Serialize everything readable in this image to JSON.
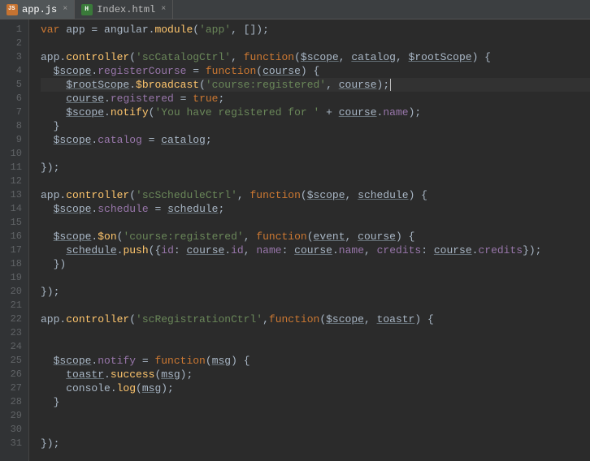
{
  "tabs": [
    {
      "name": "app.js",
      "active": true,
      "icon": "js"
    },
    {
      "name": "Index.html",
      "active": false,
      "icon": "html"
    }
  ],
  "code": {
    "lines": [
      {
        "n": 1,
        "seg": [
          {
            "t": "var ",
            "c": "kw"
          },
          {
            "t": "app = angular.",
            "c": "punc"
          },
          {
            "t": "module",
            "c": "fn"
          },
          {
            "t": "(",
            "c": "punc"
          },
          {
            "t": "'app'",
            "c": "str"
          },
          {
            "t": ", []);",
            "c": "punc"
          }
        ]
      },
      {
        "n": 2,
        "seg": []
      },
      {
        "n": 3,
        "seg": [
          {
            "t": "app.",
            "c": "punc"
          },
          {
            "t": "controller",
            "c": "fn"
          },
          {
            "t": "(",
            "c": "punc"
          },
          {
            "t": "'scCatalogCtrl'",
            "c": "str"
          },
          {
            "t": ", ",
            "c": "punc"
          },
          {
            "t": "function",
            "c": "kw"
          },
          {
            "t": "(",
            "c": "punc"
          },
          {
            "t": "$scope",
            "c": "par"
          },
          {
            "t": ", ",
            "c": "punc"
          },
          {
            "t": "catalog",
            "c": "par"
          },
          {
            "t": ", ",
            "c": "punc"
          },
          {
            "t": "$rootScope",
            "c": "par"
          },
          {
            "t": ") {",
            "c": "punc"
          }
        ]
      },
      {
        "n": 4,
        "seg": [
          {
            "t": "  ",
            "c": ""
          },
          {
            "t": "$scope",
            "c": "par"
          },
          {
            "t": ".",
            "c": "punc"
          },
          {
            "t": "registerCourse",
            "c": "id"
          },
          {
            "t": " = ",
            "c": "punc"
          },
          {
            "t": "function",
            "c": "kw"
          },
          {
            "t": "(",
            "c": "punc"
          },
          {
            "t": "course",
            "c": "par"
          },
          {
            "t": ") {",
            "c": "punc"
          }
        ]
      },
      {
        "n": 5,
        "hl": true,
        "seg": [
          {
            "t": "    ",
            "c": ""
          },
          {
            "t": "$rootScope",
            "c": "par"
          },
          {
            "t": ".",
            "c": "punc"
          },
          {
            "t": "$broadcast",
            "c": "fn"
          },
          {
            "t": "(",
            "c": "punc"
          },
          {
            "t": "'course:registered'",
            "c": "str"
          },
          {
            "t": ", ",
            "c": "punc"
          },
          {
            "t": "course",
            "c": "par"
          },
          {
            "t": ");",
            "c": "punc"
          },
          {
            "t": "",
            "c": "caret"
          }
        ]
      },
      {
        "n": 6,
        "seg": [
          {
            "t": "    ",
            "c": ""
          },
          {
            "t": "course",
            "c": "par"
          },
          {
            "t": ".",
            "c": "punc"
          },
          {
            "t": "registered",
            "c": "id"
          },
          {
            "t": " = ",
            "c": "punc"
          },
          {
            "t": "true",
            "c": "bool"
          },
          {
            "t": ";",
            "c": "punc"
          }
        ]
      },
      {
        "n": 7,
        "seg": [
          {
            "t": "    ",
            "c": ""
          },
          {
            "t": "$scope",
            "c": "par"
          },
          {
            "t": ".",
            "c": "punc"
          },
          {
            "t": "notify",
            "c": "fn"
          },
          {
            "t": "(",
            "c": "punc"
          },
          {
            "t": "'You have registered for '",
            "c": "str"
          },
          {
            "t": " + ",
            "c": "punc"
          },
          {
            "t": "course",
            "c": "par"
          },
          {
            "t": ".",
            "c": "punc"
          },
          {
            "t": "name",
            "c": "id"
          },
          {
            "t": ");",
            "c": "punc"
          }
        ]
      },
      {
        "n": 8,
        "seg": [
          {
            "t": "  }",
            "c": "punc"
          }
        ]
      },
      {
        "n": 9,
        "seg": [
          {
            "t": "  ",
            "c": ""
          },
          {
            "t": "$scope",
            "c": "par"
          },
          {
            "t": ".",
            "c": "punc"
          },
          {
            "t": "catalog",
            "c": "id"
          },
          {
            "t": " = ",
            "c": "punc"
          },
          {
            "t": "catalog",
            "c": "par"
          },
          {
            "t": ";",
            "c": "punc"
          }
        ]
      },
      {
        "n": 10,
        "seg": []
      },
      {
        "n": 11,
        "seg": [
          {
            "t": "});",
            "c": "punc"
          }
        ]
      },
      {
        "n": 12,
        "seg": []
      },
      {
        "n": 13,
        "seg": [
          {
            "t": "app.",
            "c": "punc"
          },
          {
            "t": "controller",
            "c": "fn"
          },
          {
            "t": "(",
            "c": "punc"
          },
          {
            "t": "'scScheduleCtrl'",
            "c": "str"
          },
          {
            "t": ", ",
            "c": "punc"
          },
          {
            "t": "function",
            "c": "kw"
          },
          {
            "t": "(",
            "c": "punc"
          },
          {
            "t": "$scope",
            "c": "par"
          },
          {
            "t": ", ",
            "c": "punc"
          },
          {
            "t": "schedule",
            "c": "par"
          },
          {
            "t": ") {",
            "c": "punc"
          }
        ]
      },
      {
        "n": 14,
        "seg": [
          {
            "t": "  ",
            "c": ""
          },
          {
            "t": "$scope",
            "c": "par"
          },
          {
            "t": ".",
            "c": "punc"
          },
          {
            "t": "schedule",
            "c": "id"
          },
          {
            "t": " = ",
            "c": "punc"
          },
          {
            "t": "schedule",
            "c": "par"
          },
          {
            "t": ";",
            "c": "punc"
          }
        ]
      },
      {
        "n": 15,
        "seg": []
      },
      {
        "n": 16,
        "seg": [
          {
            "t": "  ",
            "c": ""
          },
          {
            "t": "$scope",
            "c": "par"
          },
          {
            "t": ".",
            "c": "punc"
          },
          {
            "t": "$on",
            "c": "fn"
          },
          {
            "t": "(",
            "c": "punc"
          },
          {
            "t": "'course:registered'",
            "c": "str"
          },
          {
            "t": ", ",
            "c": "punc"
          },
          {
            "t": "function",
            "c": "kw"
          },
          {
            "t": "(",
            "c": "punc"
          },
          {
            "t": "event",
            "c": "par"
          },
          {
            "t": ", ",
            "c": "punc"
          },
          {
            "t": "course",
            "c": "par"
          },
          {
            "t": ") {",
            "c": "punc"
          }
        ]
      },
      {
        "n": 17,
        "seg": [
          {
            "t": "    ",
            "c": ""
          },
          {
            "t": "schedule",
            "c": "par"
          },
          {
            "t": ".",
            "c": "punc"
          },
          {
            "t": "push",
            "c": "fn"
          },
          {
            "t": "({",
            "c": "punc"
          },
          {
            "t": "id",
            "c": "id"
          },
          {
            "t": ": ",
            "c": "punc"
          },
          {
            "t": "course",
            "c": "par"
          },
          {
            "t": ".",
            "c": "punc"
          },
          {
            "t": "id",
            "c": "id"
          },
          {
            "t": ", ",
            "c": "punc"
          },
          {
            "t": "name",
            "c": "id"
          },
          {
            "t": ": ",
            "c": "punc"
          },
          {
            "t": "course",
            "c": "par"
          },
          {
            "t": ".",
            "c": "punc"
          },
          {
            "t": "name",
            "c": "id"
          },
          {
            "t": ", ",
            "c": "punc"
          },
          {
            "t": "credits",
            "c": "id"
          },
          {
            "t": ": ",
            "c": "punc"
          },
          {
            "t": "course",
            "c": "par"
          },
          {
            "t": ".",
            "c": "punc"
          },
          {
            "t": "credits",
            "c": "id"
          },
          {
            "t": "});",
            "c": "punc"
          }
        ]
      },
      {
        "n": 18,
        "seg": [
          {
            "t": "  })",
            "c": "punc"
          }
        ]
      },
      {
        "n": 19,
        "seg": []
      },
      {
        "n": 20,
        "seg": [
          {
            "t": "});",
            "c": "punc"
          }
        ]
      },
      {
        "n": 21,
        "seg": []
      },
      {
        "n": 22,
        "seg": [
          {
            "t": "app.",
            "c": "punc"
          },
          {
            "t": "controller",
            "c": "fn"
          },
          {
            "t": "(",
            "c": "punc"
          },
          {
            "t": "'scRegistrationCtrl'",
            "c": "str"
          },
          {
            "t": ",",
            "c": "punc"
          },
          {
            "t": "function",
            "c": "kw"
          },
          {
            "t": "(",
            "c": "punc"
          },
          {
            "t": "$scope",
            "c": "par"
          },
          {
            "t": ", ",
            "c": "punc"
          },
          {
            "t": "toastr",
            "c": "par"
          },
          {
            "t": ") {",
            "c": "punc"
          }
        ]
      },
      {
        "n": 23,
        "seg": []
      },
      {
        "n": 24,
        "seg": []
      },
      {
        "n": 25,
        "seg": [
          {
            "t": "  ",
            "c": ""
          },
          {
            "t": "$scope",
            "c": "par"
          },
          {
            "t": ".",
            "c": "punc"
          },
          {
            "t": "notify",
            "c": "id"
          },
          {
            "t": " = ",
            "c": "punc"
          },
          {
            "t": "function",
            "c": "kw"
          },
          {
            "t": "(",
            "c": "punc"
          },
          {
            "t": "msg",
            "c": "par"
          },
          {
            "t": ") {",
            "c": "punc"
          }
        ]
      },
      {
        "n": 26,
        "seg": [
          {
            "t": "    ",
            "c": ""
          },
          {
            "t": "toastr",
            "c": "par"
          },
          {
            "t": ".",
            "c": "punc"
          },
          {
            "t": "success",
            "c": "fn"
          },
          {
            "t": "(",
            "c": "punc"
          },
          {
            "t": "msg",
            "c": "par"
          },
          {
            "t": ");",
            "c": "punc"
          }
        ]
      },
      {
        "n": 27,
        "seg": [
          {
            "t": "    console.",
            "c": "punc"
          },
          {
            "t": "log",
            "c": "fn"
          },
          {
            "t": "(",
            "c": "punc"
          },
          {
            "t": "msg",
            "c": "par"
          },
          {
            "t": ");",
            "c": "punc"
          }
        ]
      },
      {
        "n": 28,
        "seg": [
          {
            "t": "  }",
            "c": "punc"
          }
        ]
      },
      {
        "n": 29,
        "seg": []
      },
      {
        "n": 30,
        "seg": []
      },
      {
        "n": 31,
        "seg": [
          {
            "t": "});",
            "c": "punc"
          }
        ]
      }
    ]
  }
}
